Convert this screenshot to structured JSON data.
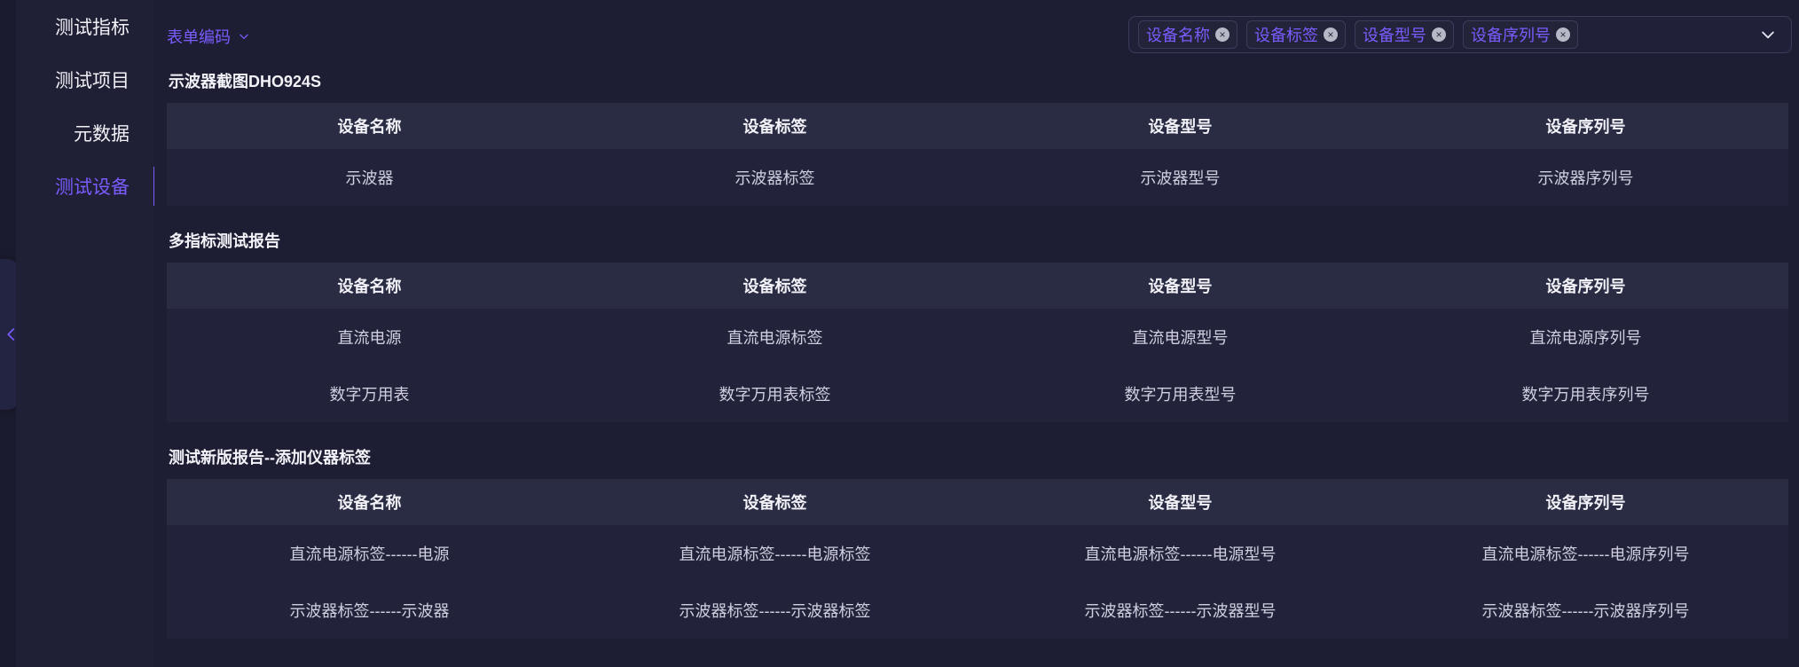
{
  "sidebar": {
    "items": [
      {
        "label": "测试指标"
      },
      {
        "label": "测试项目"
      },
      {
        "label": "元数据"
      },
      {
        "label": "测试设备",
        "active": true
      }
    ]
  },
  "toolbar": {
    "form_code_label": "表单编码",
    "selected_tags": [
      "设备名称",
      "设备标签",
      "设备型号",
      "设备序列号"
    ]
  },
  "sections": [
    {
      "title": "示波器截图DHO924S",
      "columns": [
        "设备名称",
        "设备标签",
        "设备型号",
        "设备序列号"
      ],
      "rows": [
        [
          "示波器",
          "示波器标签",
          "示波器型号",
          "示波器序列号"
        ]
      ]
    },
    {
      "title": "多指标测试报告",
      "columns": [
        "设备名称",
        "设备标签",
        "设备型号",
        "设备序列号"
      ],
      "rows": [
        [
          "直流电源",
          "直流电源标签",
          "直流电源型号",
          "直流电源序列号"
        ],
        [
          "数字万用表",
          "数字万用表标签",
          "数字万用表型号",
          "数字万用表序列号"
        ]
      ]
    },
    {
      "title": "测试新版报告--添加仪器标签",
      "columns": [
        "设备名称",
        "设备标签",
        "设备型号",
        "设备序列号"
      ],
      "rows": [
        [
          "直流电源标签------电源",
          "直流电源标签------电源标签",
          "直流电源标签------电源型号",
          "直流电源标签------电源序列号"
        ],
        [
          "示波器标签------示波器",
          "示波器标签------示波器标签",
          "示波器标签------示波器型号",
          "示波器标签------示波器序列号"
        ]
      ]
    }
  ],
  "icons": {
    "collapse": "chevron-left-icon",
    "form_code_dropdown": "chevron-down-icon",
    "tag_remove": "close-icon",
    "select_caret": "chevron-down-icon"
  },
  "colors": {
    "accent": "#7a5cff",
    "background": "#1b1b2f",
    "panel": "#1d1d33",
    "header": "#2a2c44",
    "row": "#22233a"
  }
}
